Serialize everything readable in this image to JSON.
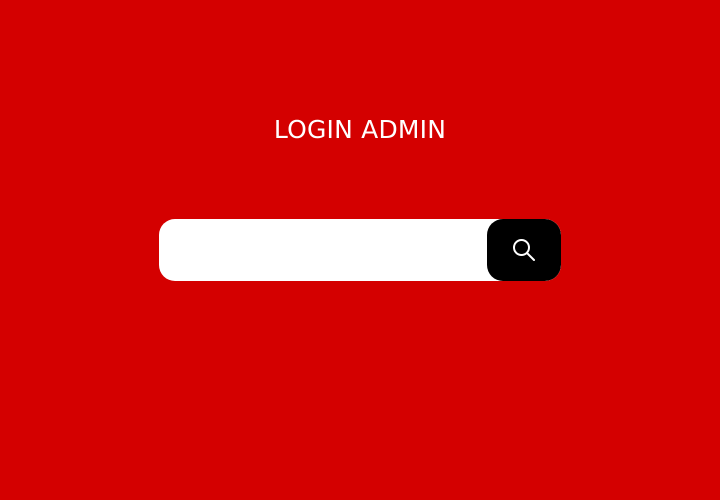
{
  "page": {
    "title": "LOGIN ADMIN",
    "background_color": "#d40000"
  },
  "search": {
    "value": "",
    "placeholder": "",
    "button_icon": "search-icon",
    "button_color": "#000000"
  }
}
